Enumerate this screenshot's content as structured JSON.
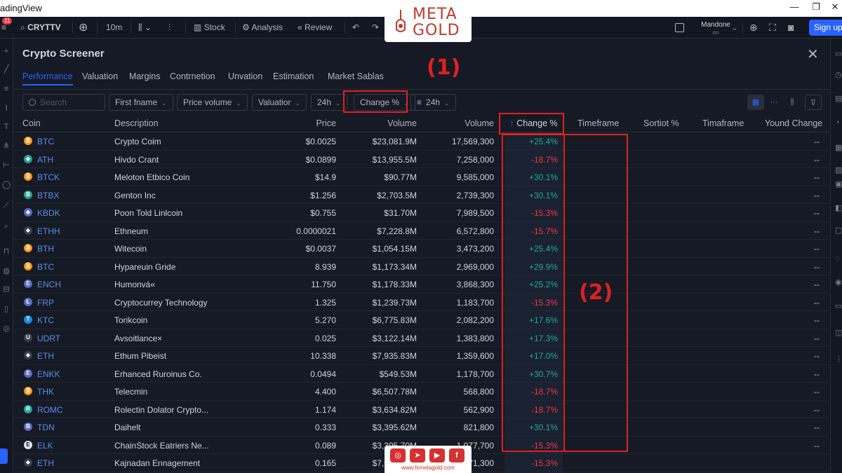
{
  "os": {
    "title": "adingView",
    "min": "—",
    "max": "❐",
    "close": "✕"
  },
  "toolbar": {
    "notif_count": "11",
    "symbol": "CRYTTV",
    "interval": "10m",
    "stock": "Stock",
    "analysis": "Analysis",
    "review": "Review",
    "user_name": "Mandone",
    "user_status": "on",
    "signup": "Sign up"
  },
  "logo": {
    "line1": "META",
    "line2": "GOLD"
  },
  "watermark": {
    "url": "www.fxmetagold.com",
    "icons": [
      "ig",
      "tg",
      "yt",
      "f"
    ]
  },
  "panel": {
    "title": "Crypto Screener",
    "close": "✕",
    "tabs": [
      "Performance",
      "Valuation",
      "Margins",
      "Contrnetion",
      "Unvation",
      "Estimation",
      "Market Sablas"
    ],
    "active_tab": "Performance"
  },
  "filters": {
    "search_placeholder": "Search",
    "first_frame": "First fname",
    "price_volume": "Price volume",
    "valuation": "Valuatior",
    "period": "24h",
    "change": "Change %",
    "sort_period": "24h"
  },
  "annotations": {
    "one": "(1)",
    "two": "(2)"
  },
  "table": {
    "headers": {
      "coin": "Coin",
      "description": "Description",
      "price": "Price",
      "volume1": "Volume",
      "volume2": "Volume",
      "change": "Change %",
      "timeframe": "Timeframe",
      "sortiot": "Sortiot %",
      "timeframe2": "Timaframe",
      "yound": "Yound Change"
    },
    "sort_icon": "↑",
    "rows": [
      {
        "ticker": "BTC",
        "desc": "Crypto Coim",
        "price": "$0.0025",
        "vol": "$23,081.9M",
        "vol2": "17,569,300",
        "chg": "+25.4%",
        "dir": "pos",
        "end": "--",
        "ic": "₿",
        "color": "#f7931a"
      },
      {
        "ticker": "ATH",
        "desc": "Hivdo Crant",
        "price": "$0.0899",
        "vol": "$13,955.5M",
        "vol2": "7,258,000",
        "chg": "-18.7%",
        "dir": "neg",
        "end": "--",
        "ic": "◆",
        "color": "#26a69a"
      },
      {
        "ticker": "BTCK",
        "desc": "Meloton Etbico Coin",
        "price": "$14.9",
        "vol": "$90.77M",
        "vol2": "9,585,000",
        "chg": "+30.1%",
        "dir": "pos",
        "end": "--",
        "ic": "₿",
        "color": "#f7931a"
      },
      {
        "ticker": "BTBX",
        "desc": "Genton Inc",
        "price": "$1.256",
        "vol": "$2,703.5M",
        "vol2": "2,739,300",
        "chg": "+30.1%",
        "dir": "pos",
        "end": "--",
        "ic": "B",
        "color": "#26a69a"
      },
      {
        "ticker": "KBDK",
        "desc": "Poon Told Linlcoin",
        "price": "$0.755",
        "vol": "$31.70M",
        "vol2": "7,989,500",
        "chg": "-15.3%",
        "dir": "neg",
        "end": "--",
        "ic": "◆",
        "color": "#5c6bc0"
      },
      {
        "ticker": "ETHH",
        "desc": "Ethneum",
        "price": "0.0000021",
        "vol": "$7,228.8M",
        "vol2": "6,572,800",
        "chg": "-15.7%",
        "dir": "neg",
        "end": "--",
        "ic": "◆",
        "color": "#3a3f4b"
      },
      {
        "ticker": "BTH",
        "desc": "Witecoin",
        "price": "$0.0037",
        "vol": "$1,054.15M",
        "vol2": "3,473,200",
        "chg": "+25.4%",
        "dir": "pos",
        "end": "--",
        "ic": "₿",
        "color": "#f7931a"
      },
      {
        "ticker": "BTC",
        "desc": "Hypareuin Gride",
        "price": "8.939",
        "vol": "$1,173.34M",
        "vol2": "2,969,000",
        "chg": "+29.9%",
        "dir": "pos",
        "end": "--",
        "ic": "₿",
        "color": "#f7931a"
      },
      {
        "ticker": "ENCH",
        "desc": "Humonvá«",
        "price": "11.750",
        "vol": "$1,178.33M",
        "vol2": "3,868,300",
        "chg": "+25.2%",
        "dir": "pos",
        "end": "--",
        "ic": "E",
        "color": "#5c6bc0"
      },
      {
        "ticker": "FRP",
        "desc": "Cryptocurrey Technology",
        "price": "1.325",
        "vol": "$1,239.73M",
        "vol2": "1,183,700",
        "chg": "-15.3%",
        "dir": "neg",
        "end": "--",
        "ic": "Ł",
        "color": "#5c6bc0"
      },
      {
        "ticker": "KTC",
        "desc": "Torikcoin",
        "price": "5.270",
        "vol": "$6,775.83M",
        "vol2": "2,082,200",
        "chg": "+17.6%",
        "dir": "pos",
        "end": "--",
        "ic": "T",
        "color": "#1e88e5"
      },
      {
        "ticker": "UDRT",
        "desc": "Avsoitlance×",
        "price": "0.025",
        "vol": "$3,122.14M",
        "vol2": "1,383,800",
        "chg": "+17.3%",
        "dir": "pos",
        "end": "--",
        "ic": "U",
        "color": "#3a3f4b"
      },
      {
        "ticker": "ETH",
        "desc": "Ethum Pibeist",
        "price": "10.338",
        "vol": "$7,935.83M",
        "vol2": "1,359,600",
        "chg": "+17.0%",
        "dir": "pos",
        "end": "--",
        "ic": "◆",
        "color": "#3a3f4b"
      },
      {
        "ticker": "ENKK",
        "desc": "Erhanced Ruroinus Co.",
        "price": "0.0494",
        "vol": "$549.53M",
        "vol2": "1,178,700",
        "chg": "+30.7%",
        "dir": "pos",
        "end": "--",
        "ic": "E",
        "color": "#5c6bc0"
      },
      {
        "ticker": "THK",
        "desc": "Telecmin",
        "price": "4.400",
        "vol": "$6,507.78M",
        "vol2": "568,800",
        "chg": "-18.7%",
        "dir": "neg",
        "end": "--",
        "ic": "₿",
        "color": "#f7931a"
      },
      {
        "ticker": "ROMC",
        "desc": "Rolectin Dolator Crypto...",
        "price": "1.174",
        "vol": "$3,634.82M",
        "vol2": "562,900",
        "chg": "-18.7%",
        "dir": "neg",
        "end": "--",
        "ic": "R",
        "color": "#26a69a"
      },
      {
        "ticker": "TDN",
        "desc": "Daihelt",
        "price": "0.333",
        "vol": "$3,395.62M",
        "vol2": "821,800",
        "chg": "+30.1%",
        "dir": "pos",
        "end": "--",
        "ic": "B",
        "color": "#5c6bc0"
      },
      {
        "ticker": "ELK",
        "desc": "ChainStock Eatriers Ne...",
        "price": "0.089",
        "vol": "$3,395.70M",
        "vol2": "1,077,700",
        "chg": "-15.3%",
        "dir": "neg",
        "end": "--",
        "ic": "E",
        "color": "#e0e3eb"
      },
      {
        "ticker": "ETH",
        "desc": "Kajnadan Ennagement",
        "price": "0.165",
        "vol": "$7,985.36M",
        "vol2": "871,300",
        "chg": "-15.3%",
        "dir": "neg",
        "end": "",
        "ic": "◆",
        "color": "#3a3f4b"
      }
    ]
  }
}
